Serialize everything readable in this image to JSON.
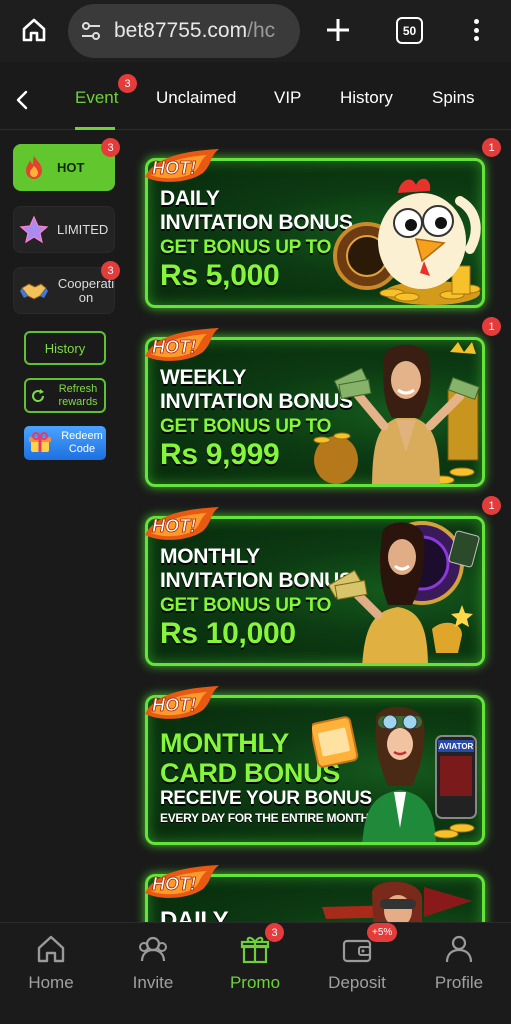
{
  "browser": {
    "url_main": "bet87755.com",
    "url_rest": "/hc",
    "tab_count": "50",
    "icons": [
      "home-icon",
      "tune-icon",
      "plus-icon",
      "more-vert-icon"
    ]
  },
  "tabs": [
    {
      "label": "Event",
      "active": true,
      "badge": "3"
    },
    {
      "label": "Unclaimed"
    },
    {
      "label": "VIP"
    },
    {
      "label": "History"
    },
    {
      "label": "Spins"
    }
  ],
  "sidebar": {
    "categories": [
      {
        "label": "HOT",
        "icon": "fire-icon",
        "active": true,
        "badge": "3"
      },
      {
        "label": "LIMITED",
        "icon": "star-icon"
      },
      {
        "label": "Cooperati on",
        "icon": "handshake-icon",
        "badge": "3"
      }
    ],
    "history_label": "History",
    "refresh_label": "Refresh rewards",
    "redeem_label": "Redeem Code"
  },
  "banners": [
    {
      "tag": "HOT!",
      "line1": "DAILY",
      "line2": "INVITATION BONUS",
      "line3": "GET BONUS UP TO",
      "amount": "Rs 5,000",
      "badge": "1",
      "art": "chicken-mascot"
    },
    {
      "tag": "HOT!",
      "line1": "WEEKLY",
      "line2": "INVITATION BONUS",
      "line3": "GET BONUS UP TO",
      "amount": "Rs 9,999",
      "badge": "1",
      "art": "woman-with-money"
    },
    {
      "tag": "HOT!",
      "line1": "MONTHLY",
      "line2": "INVITATION BONUS",
      "line3": "GET BONUS UP TO",
      "amount": "Rs 10,000",
      "badge": "1",
      "art": "woman-with-cash"
    },
    {
      "tag": "HOT!",
      "line1": "MONTHLY",
      "line2": "CARD BONUS",
      "line3": "RECEIVE YOUR BONUS",
      "line4": "EVERY DAY FOR THE ENTIRE MONTH!",
      "art": "aviator-pilot"
    },
    {
      "tag": "HOT!",
      "line1": "DAILY",
      "art": "pilot-woman"
    }
  ],
  "aviator_label": "AVIATOR",
  "bottom_nav": [
    {
      "label": "Home",
      "icon": "home-icon"
    },
    {
      "label": "Invite",
      "icon": "invite-users-icon"
    },
    {
      "label": "Promo",
      "icon": "gift-icon",
      "active": true,
      "badge": "3"
    },
    {
      "label": "Deposit",
      "icon": "wallet-icon",
      "badge": "+5%"
    },
    {
      "label": "Profile",
      "icon": "profile-icon"
    }
  ],
  "colors": {
    "accent": "#6fd13a",
    "badge": "#e43b3b",
    "background": "#1a1a1a"
  }
}
